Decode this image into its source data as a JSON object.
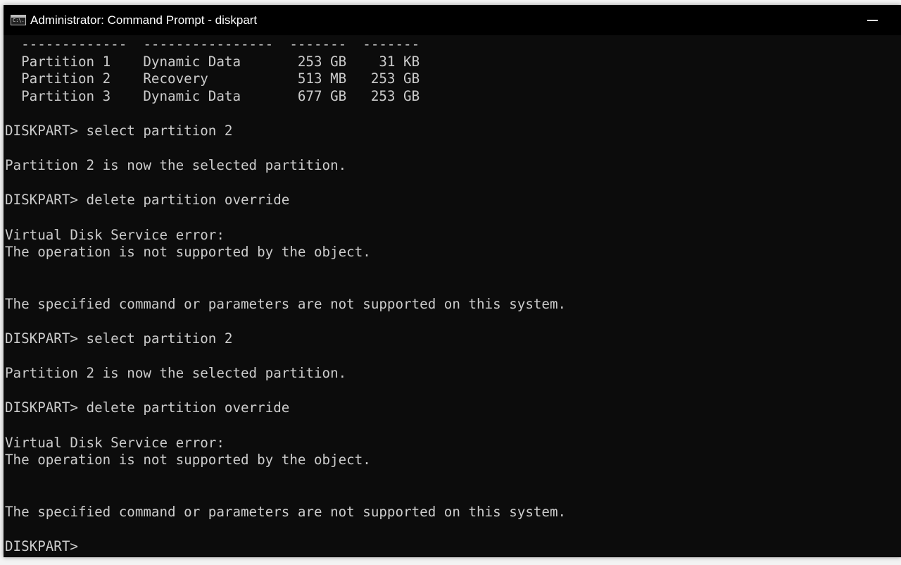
{
  "window": {
    "title": "Administrator: Command Prompt - diskpart",
    "icon": "cmd-icon",
    "icon_text": "C:\\."
  },
  "console": {
    "background": "#0c0c0c",
    "foreground": "#cccccc",
    "lines": [
      "  -------------  ----------------  -------  -------",
      "  Partition 1    Dynamic Data       253 GB    31 KB",
      "  Partition 2    Recovery           513 MB   253 GB",
      "  Partition 3    Dynamic Data       677 GB   253 GB",
      "",
      "DISKPART> select partition 2",
      "",
      "Partition 2 is now the selected partition.",
      "",
      "DISKPART> delete partition override",
      "",
      "Virtual Disk Service error:",
      "The operation is not supported by the object.",
      "",
      "",
      "The specified command or parameters are not supported on this system.",
      "",
      "DISKPART> select partition 2",
      "",
      "Partition 2 is now the selected partition.",
      "",
      "DISKPART> delete partition override",
      "",
      "Virtual Disk Service error:",
      "The operation is not supported by the object.",
      "",
      "",
      "The specified command or parameters are not supported on this system.",
      "",
      "DISKPART>"
    ]
  }
}
